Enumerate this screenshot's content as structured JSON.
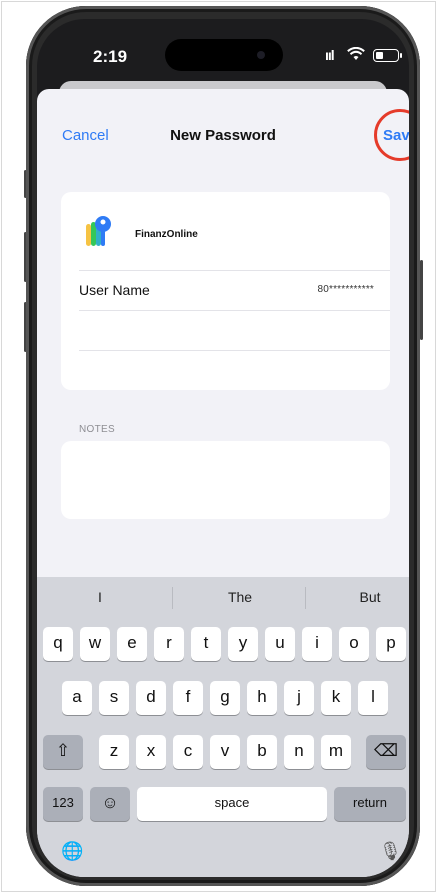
{
  "status": {
    "time": "2:19",
    "signal": "ııl",
    "wifi": "◉",
    "battery_icon": "battery-icon"
  },
  "nav": {
    "cancel": "Cancel",
    "title": "New Password",
    "save": "Save"
  },
  "entry": {
    "app_name": "FinanzOnline",
    "user_label": "User Name",
    "user_value": "80***********"
  },
  "notes": {
    "label": "NOTES"
  },
  "keyboard": {
    "suggestions": [
      "I",
      "The",
      "But"
    ],
    "row1": [
      "q",
      "w",
      "e",
      "r",
      "t",
      "y",
      "u",
      "i",
      "o",
      "p"
    ],
    "row2": [
      "a",
      "s",
      "d",
      "f",
      "g",
      "h",
      "j",
      "k",
      "l"
    ],
    "row3": [
      "z",
      "x",
      "c",
      "v",
      "b",
      "n",
      "m"
    ],
    "shift": "⇧",
    "delete": "⌫",
    "numbers": "123",
    "emoji": "☺",
    "space": "space",
    "return": "return",
    "globe": "🌐",
    "mic": "🎙"
  },
  "colors": {
    "accent": "#2f7bf5",
    "highlight": "#e53b2a"
  }
}
